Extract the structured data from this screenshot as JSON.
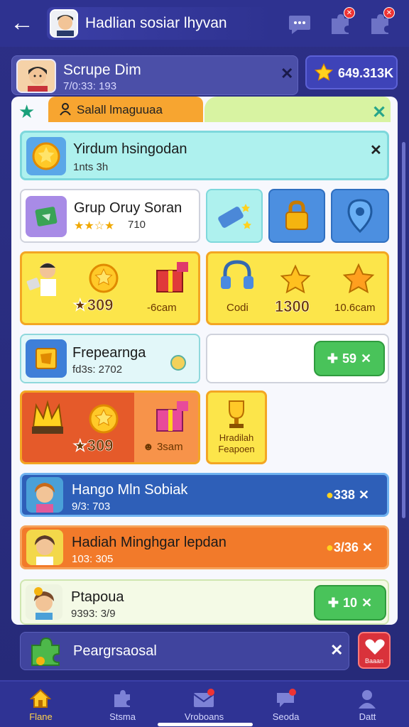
{
  "header": {
    "title": "Hadlian sosiar lhyvan"
  },
  "profile": {
    "name": "Scrupe Dim",
    "sub": "7/0:33: 193",
    "coins": "649.313K"
  },
  "tabs": {
    "active_label": "Salall lmaguuaa"
  },
  "cards": {
    "daily": {
      "title": "Yirdum hsingodan",
      "sub": "1nts 3h"
    },
    "group": {
      "title": "Grup  Oruy Soran",
      "sub": "710"
    },
    "reward_left": {
      "amount": "309",
      "amount2": "-6cam"
    },
    "reward_right": {
      "label": "Codi",
      "amount": "1300",
      "amount2": "10.6cam"
    },
    "frepe": {
      "title": "Frepearnga",
      "sub": "fd3s: 2702",
      "button": "59"
    },
    "reward_orange": {
      "amount": "309",
      "amount2": "3sam"
    },
    "trophy_label": "Hradilah Feapoen"
  },
  "list": [
    {
      "title": "Hango Mln Sobiak",
      "sub": "9/3: 703",
      "amount": "338"
    },
    {
      "title": "Hadiah Minghgar lepdan",
      "sub": "103: 305",
      "amount": "3/36"
    },
    {
      "title": "Ptapoua",
      "sub": "9393: 3/9",
      "button": "10"
    }
  ],
  "banner": {
    "label": "Peargrsaosal",
    "right": "Baaan"
  },
  "nav": [
    {
      "label": "Flane",
      "icon": "home-icon"
    },
    {
      "label": "Stsma",
      "icon": "puzzle-icon"
    },
    {
      "label": "Vroboans",
      "icon": "mail-icon"
    },
    {
      "label": "Seoda",
      "icon": "chat-icon"
    },
    {
      "label": "Datt",
      "icon": "profile-icon"
    }
  ],
  "colors": {
    "background": "#2c2f86",
    "accent_orange": "#f7a530",
    "accent_yellow": "#fce54a",
    "accent_green": "#49c35a",
    "list_blue": "#2e5fb8",
    "list_orange": "#f27a2a"
  }
}
